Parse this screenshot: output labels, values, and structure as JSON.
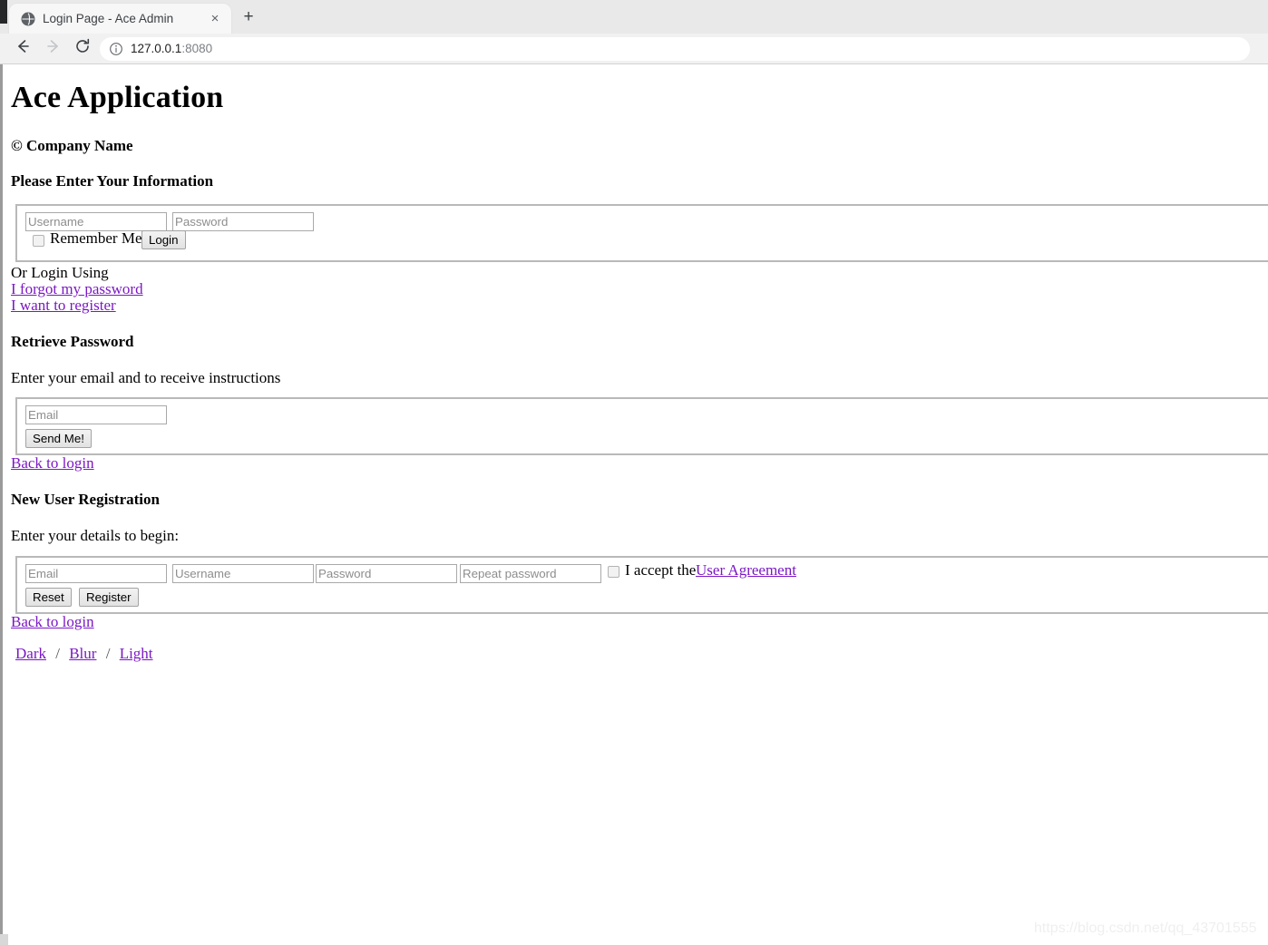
{
  "browser": {
    "tab": {
      "title": "Login Page - Ace Admin",
      "favicon_name": "globe-icon",
      "close_label": "×"
    },
    "new_tab_label": "+",
    "nav": {
      "back_label": "←",
      "forward_label": "→",
      "reload_label": "↻"
    },
    "omnibox": {
      "host": "127.0.0.1",
      "port": ":8080",
      "info_icon": "info-circle-icon"
    }
  },
  "page": {
    "app_title": "Ace Application",
    "company": "© Company Name",
    "login": {
      "heading": "Please Enter Your Information",
      "username_placeholder": "Username",
      "password_placeholder": "Password",
      "remember_label": "Remember Me",
      "login_button": "Login",
      "or_login_using": "Or Login Using",
      "forgot_link": "I forgot my password",
      "register_link": "I want to register"
    },
    "retrieve": {
      "heading": "Retrieve Password",
      "instructions": "Enter your email and to receive instructions",
      "email_placeholder": "Email",
      "send_button": "Send Me!",
      "back_link": "Back to login"
    },
    "register": {
      "heading": "New User Registration",
      "instructions": "Enter your details to begin:",
      "email_placeholder": "Email",
      "username_placeholder": "Username",
      "password_placeholder": "Password",
      "repeat_password_placeholder": "Repeat password",
      "accept_label": "I accept the",
      "agreement_link": "User Agreement",
      "reset_button": "Reset",
      "register_button": "Register",
      "back_link": "Back to login"
    },
    "themes": {
      "dark": "Dark",
      "blur": "Blur",
      "light": "Light",
      "separator": "/"
    },
    "watermark": "https://blog.csdn.net/qq_43701555"
  },
  "colors": {
    "link": "#7b18c4",
    "tabstrip": "#e9e9ea",
    "toolbar": "#f1f1f2",
    "form_border": "#b9b9b9",
    "placeholder": "#8d8d8d"
  }
}
